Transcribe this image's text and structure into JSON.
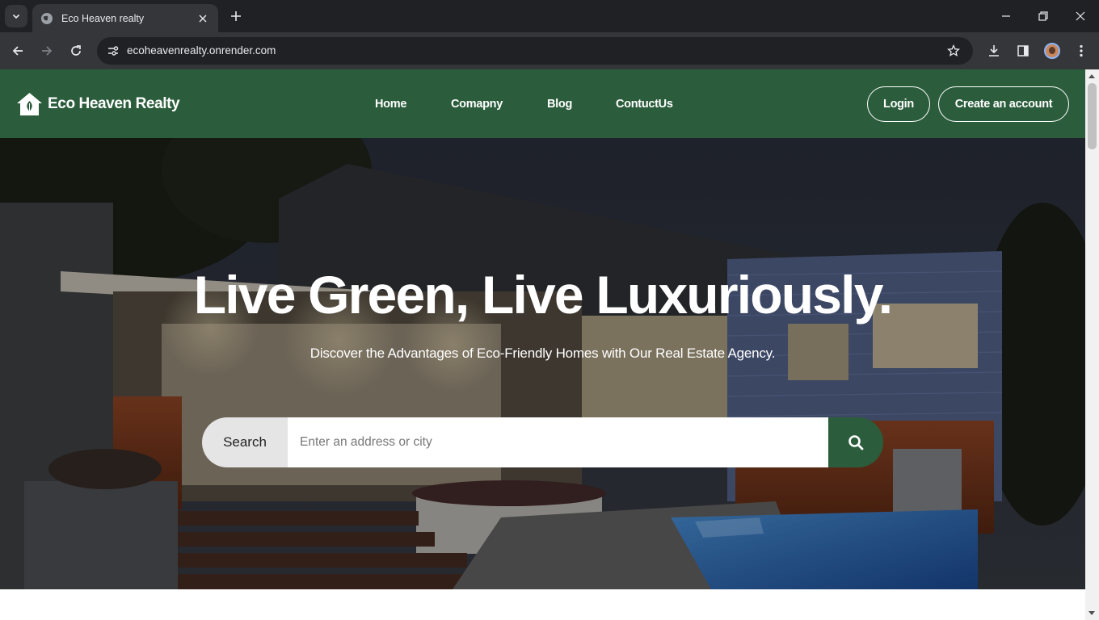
{
  "browser": {
    "tab": {
      "title": "Eco Heaven realty",
      "favicon": "globe-icon"
    },
    "url": "ecoheavenrealty.onrender.com",
    "icons": [
      "tab-search-icon",
      "close-icon",
      "plus-icon",
      "minimize-icon",
      "restore-icon",
      "close-window-icon",
      "back-arrow-icon",
      "forward-arrow-icon",
      "reload-icon",
      "site-info-icon",
      "star-icon",
      "download-icon",
      "side-panel-icon",
      "profile-avatar",
      "kebab-menu-icon"
    ]
  },
  "site": {
    "brand": {
      "name": "Eco Heaven Realty",
      "logo": "house-leaf-icon"
    },
    "nav": [
      "Home",
      "Comapny",
      "Blog",
      "ContuctUs"
    ],
    "auth": {
      "login": "Login",
      "signup": "Create an account"
    },
    "colors": {
      "primary": "#2b5d3c",
      "white": "#ffffff"
    }
  },
  "hero": {
    "title": "Live Green, Live Luxuriously.",
    "subtitle": "Discover the Advantages of Eco-Friendly Homes with Our Real Estate Agency.",
    "search": {
      "label": "Search",
      "placeholder": "Enter an address or city",
      "button_icon": "search-icon"
    }
  }
}
